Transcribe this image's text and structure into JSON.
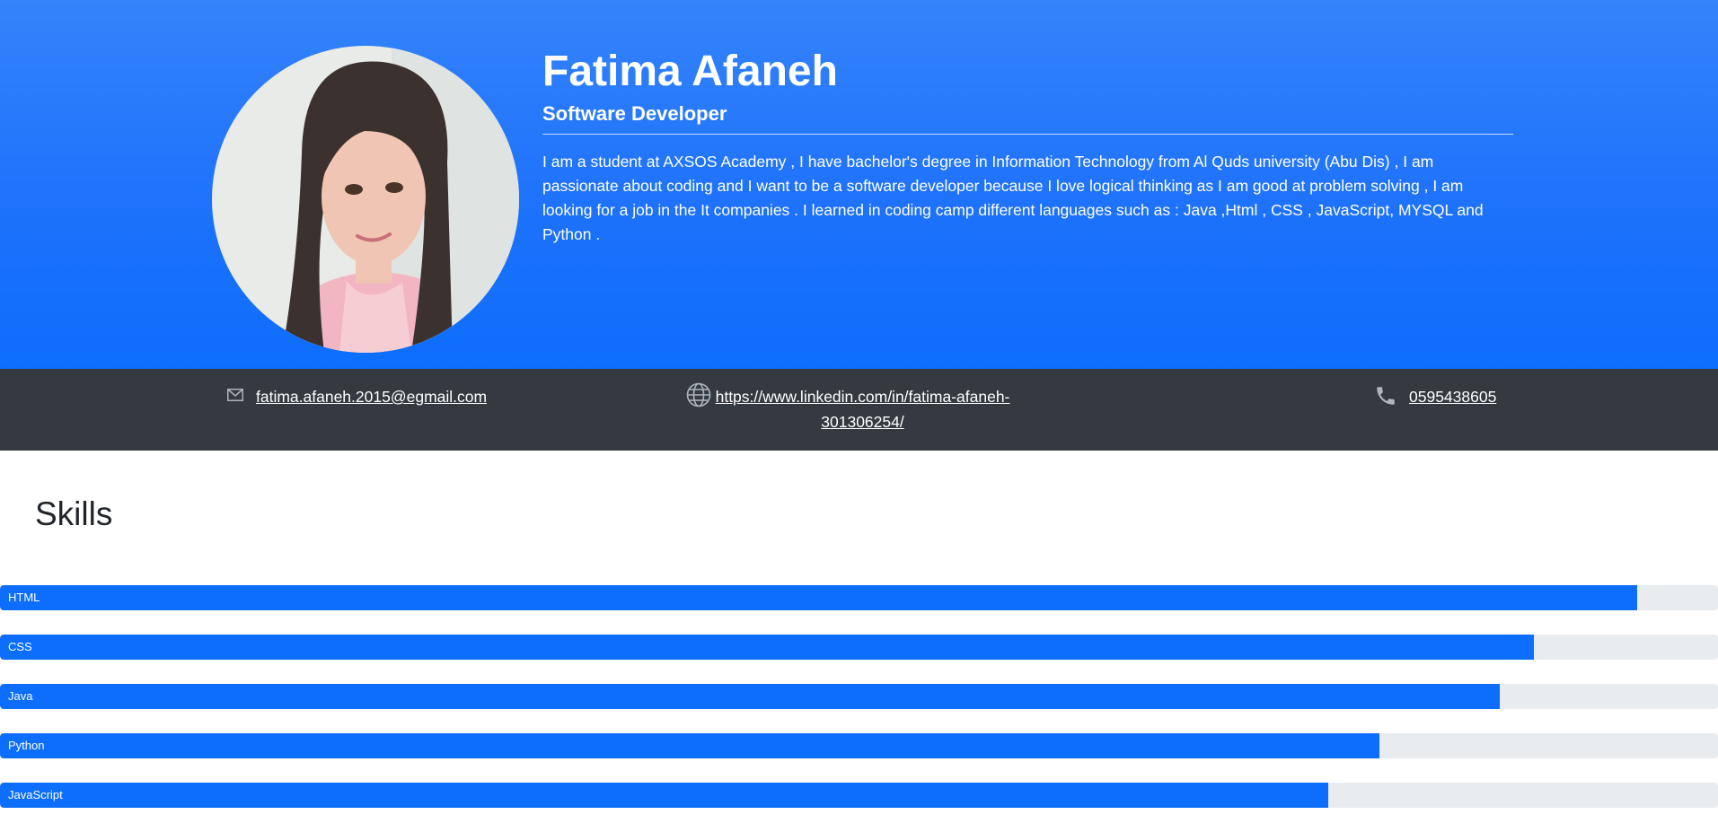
{
  "profile": {
    "name": "Fatima Afaneh",
    "title": "Software Developer",
    "bio": "I am a student at AXSOS Academy , I have bachelor's degree in Information Technology from Al Quds university (Abu Dis) , I am passionate about coding and I want to be a software developer because I love logical thinking as I am good at problem solving , I am looking for a job in the It companies . I learned in coding camp different languages such as : Java ,Html , CSS , JavaScript, MYSQL and Python ."
  },
  "contact": {
    "email": "fatima.afaneh.2015@egmail.com",
    "linkedin": "https://www.linkedin.com/in/fatima-afaneh-301306254/",
    "phone": "0595438605"
  },
  "skills": {
    "heading": "Skills",
    "items": [
      {
        "label": "HTML",
        "percent": 95.3
      },
      {
        "label": "CSS",
        "percent": 89.3
      },
      {
        "label": "Java",
        "percent": 87.3
      },
      {
        "label": "Python",
        "percent": 80.3
      },
      {
        "label": "JavaScript",
        "percent": 77.3
      }
    ]
  },
  "colors": {
    "header_top": "#3583fb",
    "header_bottom": "#0d6efd",
    "contact_bar": "#343a40",
    "progress_fill": "#0d6efd",
    "progress_track": "#e9ecef"
  },
  "icons": {
    "email": "envelope-icon",
    "linkedin": "globe-icon",
    "phone": "phone-icon"
  }
}
